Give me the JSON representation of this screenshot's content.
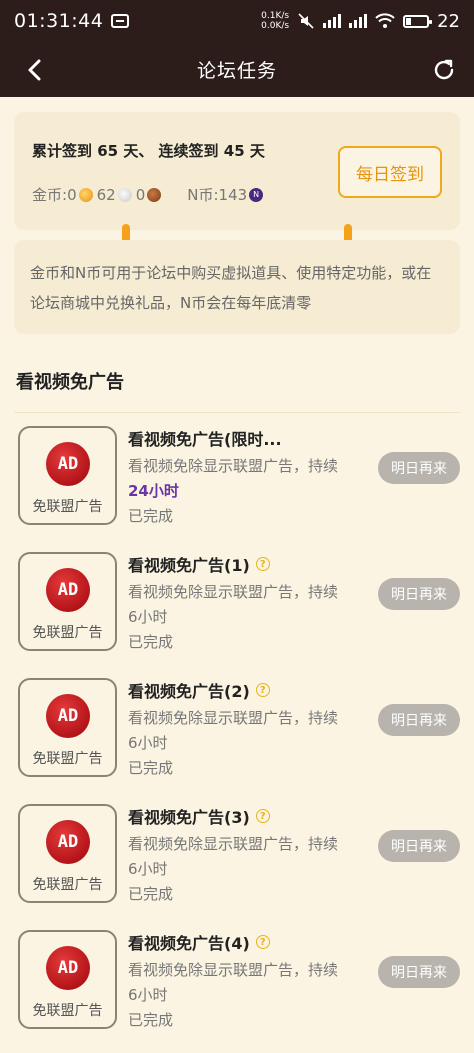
{
  "status_bar": {
    "time": "01:31:44",
    "speed_up": "0.1K/s",
    "speed_down": "0.0K/s",
    "battery": "22"
  },
  "nav": {
    "title": "论坛任务"
  },
  "checkin": {
    "streak_text": "累计签到 65 天、 连续签到 45 天",
    "coins_label": "金币: ",
    "gold_count": "0",
    "silver_count": "62",
    "bronze_count": "0",
    "n_label": "N币: ",
    "n_count": "143",
    "n_glyph": "N",
    "button": "每日签到"
  },
  "info_text": "金币和N币可用于论坛中购买虚拟道具、使用特定功能，或在论坛商城中兑换礼品，N币会在每年底清零",
  "section_title": "看视频免广告",
  "tasks": [
    {
      "name": "看视频免广告(限时...",
      "desc": "看视频免除显示联盟广告，持续",
      "duration": "24小时",
      "status": "已完成",
      "button": "明日再来",
      "icon_label": "免联盟广告",
      "ad": "AD",
      "help": ""
    },
    {
      "name": "看视频免广告(1)",
      "desc": "看视频免除显示联盟广告，持续",
      "duration": "6小时",
      "status": "已完成",
      "button": "明日再来",
      "icon_label": "免联盟广告",
      "ad": "AD",
      "help": "?"
    },
    {
      "name": "看视频免广告(2)",
      "desc": "看视频免除显示联盟广告，持续",
      "duration": "6小时",
      "status": "已完成",
      "button": "明日再来",
      "icon_label": "免联盟广告",
      "ad": "AD",
      "help": "?"
    },
    {
      "name": "看视频免广告(3)",
      "desc": "看视频免除显示联盟广告，持续",
      "duration": "6小时",
      "status": "已完成",
      "button": "明日再来",
      "icon_label": "免联盟广告",
      "ad": "AD",
      "help": "?"
    },
    {
      "name": "看视频免广告(4)",
      "desc": "看视频免除显示联盟广告，持续",
      "duration": "6小时",
      "status": "已完成",
      "button": "明日再来",
      "icon_label": "免联盟广告",
      "ad": "AD",
      "help": "?"
    }
  ],
  "colors": {
    "header_bg": "#2c1d1b",
    "accent": "#f0a91e",
    "page_bg": "#fbf4e2",
    "purple": "#6a35a6"
  }
}
